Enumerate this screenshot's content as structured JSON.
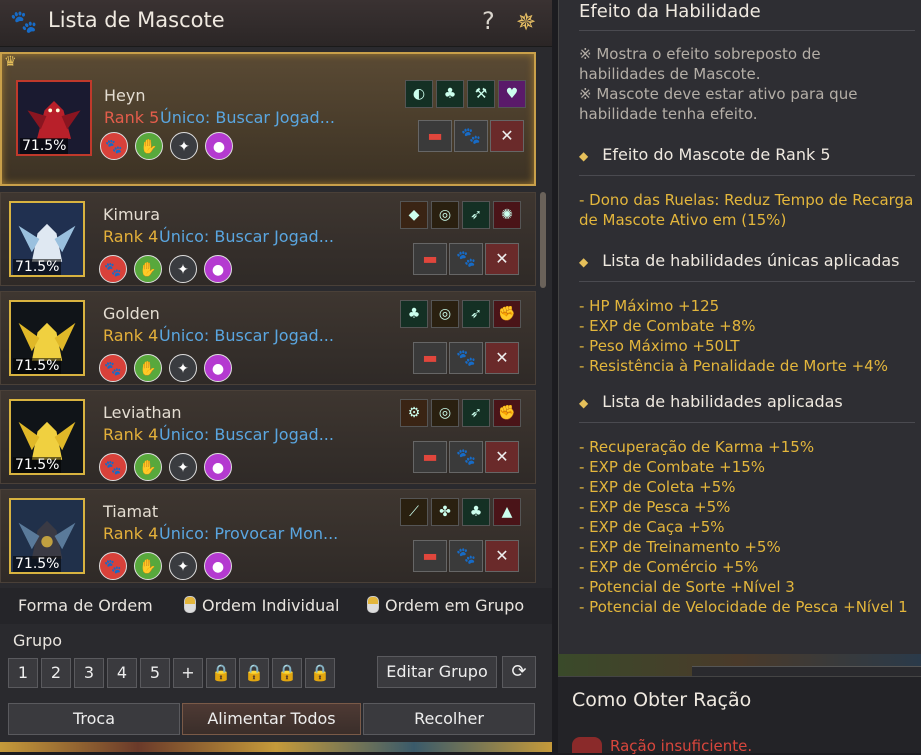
{
  "window": {
    "title": "Lista de Mascote",
    "help": "?"
  },
  "pets": [
    {
      "name": "Heyn",
      "rank": "Rank 5",
      "skill": "Único: Buscar Jogad...",
      "food": "71.5%",
      "selected": true
    },
    {
      "name": "Kimura",
      "rank": "Rank 4",
      "skill": "Único: Buscar Jogad...",
      "food": "71.5%",
      "selected": false
    },
    {
      "name": "Golden",
      "rank": "Rank 4",
      "skill": "Único: Buscar Jogad...",
      "food": "71.5%",
      "selected": false
    },
    {
      "name": "Leviathan",
      "rank": "Rank 4",
      "skill": "Único: Buscar Jogad...",
      "food": "71.5%",
      "selected": false
    },
    {
      "name": "Tiamat",
      "rank": "Rank 4",
      "skill": "Único: Provocar Mon...",
      "food": "71.5%",
      "selected": false
    }
  ],
  "order": {
    "label": "Forma de Ordem",
    "individual": "Ordem Individual",
    "group": "Ordem em Grupo"
  },
  "group": {
    "label": "Grupo",
    "slots": [
      "1",
      "2",
      "3",
      "4",
      "5"
    ],
    "add": "+",
    "edit": "Editar Grupo"
  },
  "bottom": {
    "swap": "Troca",
    "feed_all": "Alimentar Todos",
    "collect": "Recolher"
  },
  "effects": {
    "title": "Efeito da Habilidade",
    "notes": [
      "※ Mostra o efeito sobreposto de habilidades de Mascote.",
      "※ Mascote deve estar ativo para que habilidade tenha efeito."
    ],
    "rank_title": "Efeito do Mascote de Rank 5",
    "rank_effect": "- Dono das Ruelas: Reduz Tempo de Recarga de Mascote Ativo em (15%)",
    "unique_title": "Lista de habilidades únicas aplicadas",
    "unique_list": [
      "- HP Máximo +125",
      "- EXP de Combate +8%",
      "- Peso Máximo +50LT",
      "- Resistência à Penalidade de Morte +4%"
    ],
    "applied_title": "Lista de habilidades aplicadas",
    "applied_list": [
      "- Recuperação de Karma +15%",
      "- EXP de Combate +15%",
      "- EXP de Coleta +5%",
      "- EXP de Pesca +5%",
      "- EXP de Caça +5%",
      "- EXP de Treinamento +5%",
      "- EXP de Comércio +5%",
      "- Potencial de Sorte +Nível 3",
      "- Potencial de Velocidade de Pesca +Nível 1"
    ]
  },
  "obtain": {
    "title": "Como Obter Ração",
    "warning": "Ração insuficiente."
  }
}
